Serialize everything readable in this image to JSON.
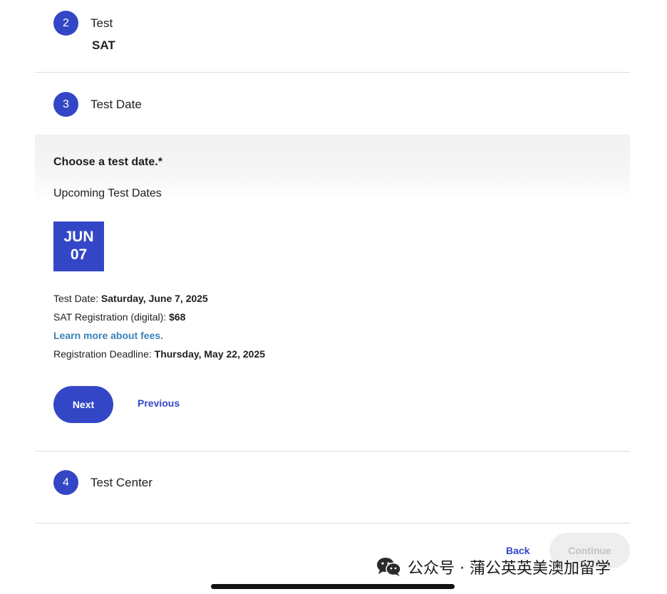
{
  "steps": {
    "test": {
      "number": "2",
      "title": "Test",
      "value": "SAT"
    },
    "test_date": {
      "number": "3",
      "title": "Test Date"
    },
    "test_center": {
      "number": "4",
      "title": "Test Center"
    }
  },
  "date_selection": {
    "prompt": "Choose a test date.*",
    "subheading": "Upcoming Test Dates",
    "selected_date": {
      "month": "JUN",
      "day": "07"
    },
    "details": {
      "test_date_label": "Test Date: ",
      "test_date_value": "Saturday, June 7, 2025",
      "registration_label": "SAT Registration (digital): ",
      "registration_value": "$68",
      "fees_link": "Learn more about fees.",
      "deadline_label": "Registration Deadline: ",
      "deadline_value": "Thursday, May 22, 2025"
    },
    "next_label": "Next",
    "previous_label": "Previous"
  },
  "footer": {
    "back_label": "Back",
    "continue_label": "Continue"
  },
  "watermark": {
    "text": "公众号 · 蒲公英英美澳加留学",
    "icon": "wechat-icon"
  },
  "colors": {
    "primary": "#3347c6",
    "link": "#3b82b8",
    "disabled_bg": "#eeeeee",
    "disabled_text": "#c2c2c2"
  }
}
